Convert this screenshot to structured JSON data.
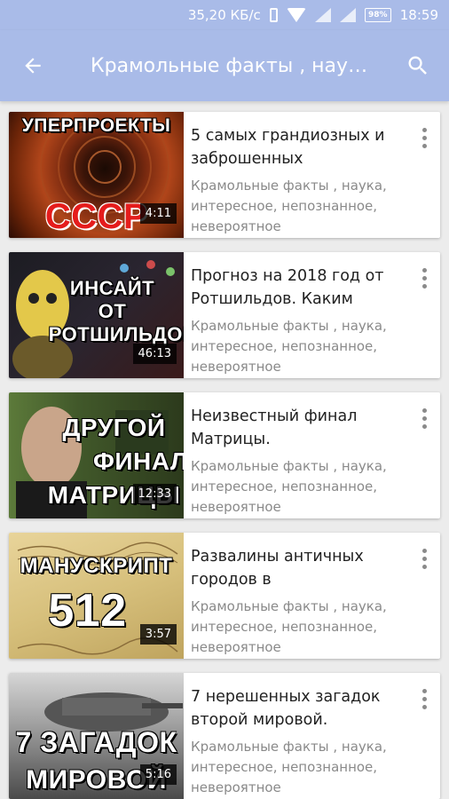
{
  "status_bar": {
    "speed": "35,20 КБ/с",
    "battery": "98%",
    "time": "18:59"
  },
  "app_bar": {
    "title": "Крамольные факты , наука , интересное, непознанное, невероятное",
    "back_icon": "arrow-back-icon",
    "search_icon": "search-icon"
  },
  "videos": [
    {
      "thumb_lines": [
        "УПЕРПРОЕКТЫ",
        "СССР"
      ],
      "duration": "4:11",
      "title": "5 самых грандиозных и заброшенных",
      "channel": "Крамольные факты , наука, интересное, непознанное, невероятное"
    },
    {
      "thumb_lines": [
        "ИНСАЙТ",
        "ОТ",
        "РОТШИЛЬДОВ"
      ],
      "duration": "46:13",
      "title": "Прогноз на 2018 год от Ротшильдов. Каким",
      "channel": "Крамольные факты , наука, интересное, непознанное, невероятное"
    },
    {
      "thumb_lines": [
        "ДРУГОЙ",
        "ФИНАЛ",
        "МАТРИЦЫ"
      ],
      "duration": "12:33",
      "title": "Неизвестный финал Матрицы.",
      "channel": "Крамольные факты , наука, интересное, непознанное, невероятное"
    },
    {
      "thumb_lines": [
        "МАНУСКРИПТ",
        "512"
      ],
      "duration": "3:57",
      "title": "Развалины античных городов в",
      "channel": "Крамольные факты , наука, интересное, непознанное, невероятное"
    },
    {
      "thumb_lines": [
        "7 ЗАГАДОК",
        "МИРОВОЙ"
      ],
      "duration": "5:16",
      "title": "7 нерешенных загадок второй мировой.",
      "channel": "Крамольные факты , наука, интересное, непознанное, невероятное"
    }
  ]
}
